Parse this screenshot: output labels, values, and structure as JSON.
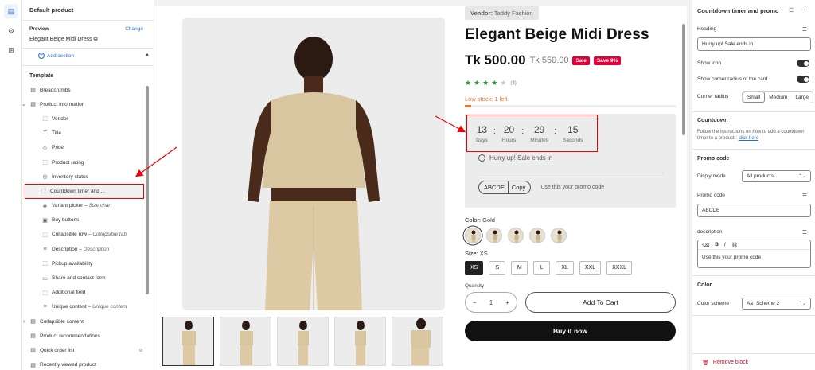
{
  "rail": {
    "icons": [
      "sections-icon",
      "settings-icon",
      "apps-icon"
    ]
  },
  "sidebar": {
    "title": "Default product",
    "preview_label": "Preview",
    "change_label": "Change",
    "preview_product": "Elegant Beige Midi Dress",
    "add_section": "Add section",
    "template_label": "Template",
    "items": [
      {
        "label": "Breadcrumbs",
        "sub": "",
        "icon": "▤",
        "indent": 1,
        "selected": false
      },
      {
        "label": "Product information",
        "sub": "",
        "icon": "▤",
        "indent": 1,
        "selected": false,
        "caret": "⌄"
      },
      {
        "label": "Vendor",
        "sub": "",
        "icon": "⬚",
        "indent": 2,
        "selected": false
      },
      {
        "label": "Title",
        "sub": "",
        "icon": "T",
        "indent": 2,
        "selected": false
      },
      {
        "label": "Price",
        "sub": "",
        "icon": "◇",
        "indent": 2,
        "selected": false
      },
      {
        "label": "Product rating",
        "sub": "",
        "icon": "⬚",
        "indent": 2,
        "selected": false
      },
      {
        "label": "Inventory status",
        "sub": "",
        "icon": "◎",
        "indent": 2,
        "selected": false
      },
      {
        "label": "Countdown timer and ...",
        "sub": "",
        "icon": "⬚",
        "indent": 2,
        "selected": true
      },
      {
        "label": "Variant picker",
        "sub": "Size chart",
        "icon": "◈",
        "indent": 2,
        "selected": false
      },
      {
        "label": "Buy buttons",
        "sub": "",
        "icon": "▣",
        "indent": 2,
        "selected": false
      },
      {
        "label": "Collapsible row",
        "sub": "Collapsible tab",
        "icon": "⬚",
        "indent": 2,
        "selected": false
      },
      {
        "label": "Description",
        "sub": "Description",
        "icon": "≡",
        "indent": 2,
        "selected": false
      },
      {
        "label": "Pickup availability",
        "sub": "",
        "icon": "⬚",
        "indent": 2,
        "selected": false
      },
      {
        "label": "Share and contact form",
        "sub": "",
        "icon": "▭",
        "indent": 2,
        "selected": false
      },
      {
        "label": "Additional field",
        "sub": "",
        "icon": "⬚",
        "indent": 2,
        "selected": false
      },
      {
        "label": "Unique content",
        "sub": "Unique content",
        "icon": "≡",
        "indent": 2,
        "selected": false
      },
      {
        "label": "Collapsible content",
        "sub": "",
        "icon": "▤",
        "indent": 1,
        "selected": false,
        "caret": "›"
      },
      {
        "label": "Product recommendations",
        "sub": "",
        "icon": "▤",
        "indent": 1,
        "selected": false
      },
      {
        "label": "Quick order list",
        "sub": "",
        "icon": "▤",
        "indent": 1,
        "selected": false,
        "hidden": true
      },
      {
        "label": "Recently viewed product",
        "sub": "",
        "icon": "▤",
        "indent": 1,
        "selected": false
      },
      {
        "label": "Add section",
        "sub": "",
        "icon": "⊕",
        "indent": 1,
        "selected": false,
        "link": true
      }
    ]
  },
  "product": {
    "vendor_label": "Vendor:",
    "vendor": "Taddy Fashion",
    "title": "Elegant Beige Midi Dress",
    "price": "Tk 500.00",
    "compare_price": "Tk 550.00",
    "sale_badge": "Sale",
    "save_badge": "Save 9%",
    "rating": 4,
    "rating_count": "(3)",
    "stock_text": "Low stock: 1 left",
    "stock_fraction": 0.03,
    "countdown": {
      "units": [
        {
          "value": "13",
          "label": "Days"
        },
        {
          "value": "20",
          "label": "Hours"
        },
        {
          "value": "29",
          "label": "Minutes"
        },
        {
          "value": "15",
          "label": "Seconds"
        }
      ],
      "heading": "Hurry up! Sale ends in"
    },
    "promo": {
      "code": "ABCDE",
      "copy": "Copy",
      "description": "Use this your promo code"
    },
    "color_label": "Color:",
    "color_value": "Gold",
    "swatch_count": 5,
    "size_label": "Size:",
    "size_value": "XS",
    "sizes": [
      "XS",
      "S",
      "M",
      "L",
      "XL",
      "XXL",
      "XXXL"
    ],
    "selected_size": "XS",
    "quantity_label": "Quantity",
    "quantity": "1",
    "minus": "−",
    "plus": "+",
    "add_to_cart": "Add To Cart",
    "buy_now": "Buy it now",
    "colors": {
      "sale": "#e4003b",
      "stock": "#f0712b",
      "star": "#2a9d3b"
    }
  },
  "panel": {
    "title": "Countdown timer and promo",
    "heading_label": "Heading",
    "heading_value": "Hurry up! Sale ends in",
    "show_icon": "Show icon",
    "show_corner": "Show corner radius of the card",
    "corner_radius": "Corner radius",
    "radius_options": [
      "Small",
      "Medium",
      "Large"
    ],
    "radius_selected": "Small",
    "countdown_title": "Countdown",
    "countdown_help": "Follow the instructions on how to add a countdown timer to a product.",
    "click_here": "click here",
    "promo_title": "Promo code",
    "display_mode_label": "Disply mode",
    "display_mode_value": "All products",
    "promo_code_label": "Promo code",
    "promo_code_value": "ABCDE",
    "description_label": "description",
    "description_value": "Use this your promo code",
    "color_title": "Color",
    "color_scheme_label": "Color scheme",
    "color_scheme_value": "Scheme 2",
    "remove_block": "Remove block"
  }
}
